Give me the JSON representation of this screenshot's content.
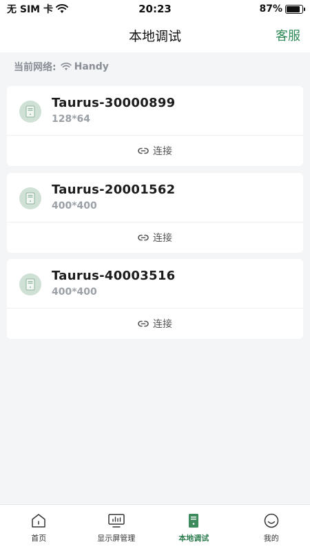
{
  "status_bar": {
    "carrier": "无 SIM 卡",
    "time": "20:23",
    "battery_percent": "87%",
    "battery_level": 0.87
  },
  "nav": {
    "title": "本地调试",
    "right_action": "客服"
  },
  "network": {
    "label": "当前网络:",
    "ssid": "Handy"
  },
  "devices": [
    {
      "name": "Taurus-30000899",
      "resolution": "128*64",
      "connect_label": "连接"
    },
    {
      "name": "Taurus-20001562",
      "resolution": "400*400",
      "connect_label": "连接"
    },
    {
      "name": "Taurus-40003516",
      "resolution": "400*400",
      "connect_label": "连接"
    }
  ],
  "tabs": [
    {
      "label": "首页",
      "icon": "home-icon",
      "active": false
    },
    {
      "label": "显示屏管理",
      "icon": "display-icon",
      "active": false
    },
    {
      "label": "本地调试",
      "icon": "local-debug-icon",
      "active": true
    },
    {
      "label": "我的",
      "icon": "profile-icon",
      "active": false
    }
  ],
  "colors": {
    "accent": "#2e8b57",
    "active_tab": "#2e7d4f",
    "icon_bg": "#cfe0d5",
    "background": "#f4f5f7"
  }
}
